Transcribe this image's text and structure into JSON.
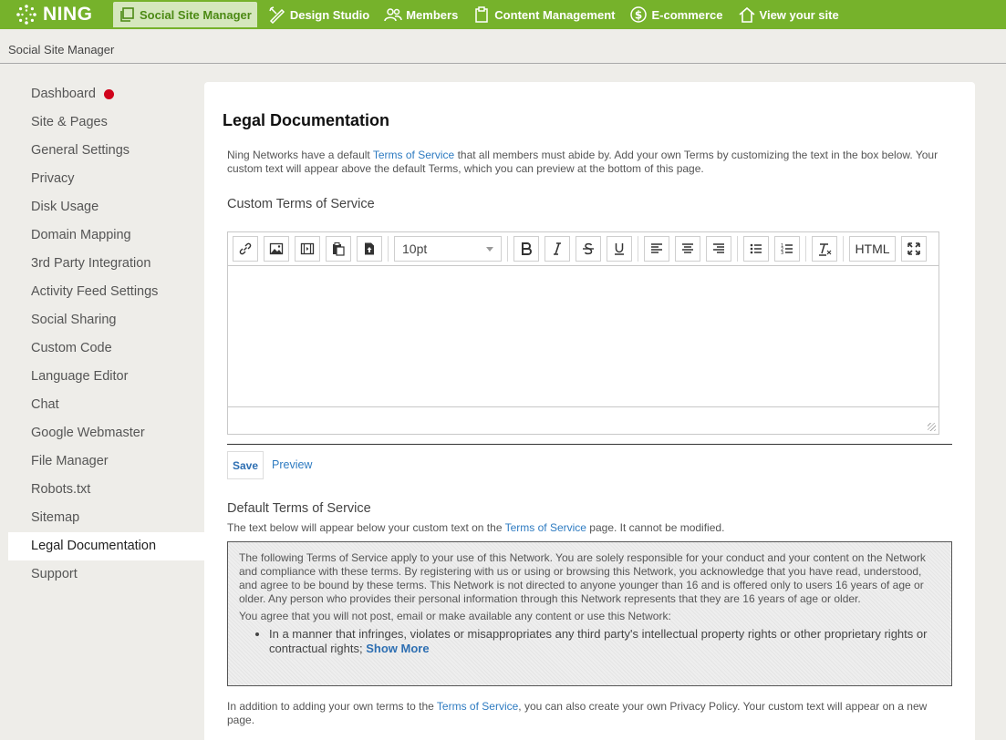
{
  "app": {
    "logo_text": "NING",
    "nav": [
      {
        "label": "Social Site Manager",
        "icon": "copy-window-icon"
      },
      {
        "label": "Design Studio",
        "icon": "design-pencil-icon"
      },
      {
        "label": "Members",
        "icon": "members-icon"
      },
      {
        "label": "Content Management",
        "icon": "clipboard-icon"
      },
      {
        "label": "E-commerce",
        "icon": "dollar-icon"
      },
      {
        "label": "View your site",
        "icon": "home-icon"
      }
    ],
    "brand_color": "#76b22b"
  },
  "breadcrumb": "Social Site Manager",
  "sidebar": {
    "items": [
      "Dashboard",
      "Site & Pages",
      "General Settings",
      "Privacy",
      "Disk Usage",
      "Domain Mapping",
      "3rd Party Integration",
      "Activity Feed Settings",
      "Social Sharing",
      "Custom Code",
      "Language Editor",
      "Chat",
      "Google Webmaster",
      "File Manager",
      "Robots.txt",
      "Sitemap",
      "Legal Documentation",
      "Support"
    ],
    "active": "Legal Documentation"
  },
  "main": {
    "title": "Legal Documentation",
    "intro_before": "Ning Networks have a default ",
    "intro_link": "Terms of Service",
    "intro_after": " that all members must abide by. Add your own Terms by customizing the text in the box below. Your custom text will appear above the default Terms, which you can preview at the bottom of this page.",
    "custom_heading": "Custom Terms of Service",
    "editor": {
      "font_size": "10pt",
      "html_label": "HTML",
      "content": ""
    },
    "save_label": "Save",
    "preview_label": "Preview",
    "default_heading": "Default Terms of Service",
    "default_note_before": "The text below will appear below your custom text on the ",
    "default_note_link": "Terms of Service",
    "default_note_after": " page. It cannot be modified.",
    "tos_para1": "The following Terms of Service apply to your use of this Network. You are solely responsible for your conduct and your content on the Network and compliance with these terms. By registering with us or using or browsing this Network, you acknowledge that you have read, understood, and agree to be bound by these terms. This Network is not directed to anyone younger than 16 and is offered only to users 16 years of age or older. Any person who provides their personal information through this Network represents that they are 16 years of age or older.",
    "tos_para2": "You agree that you will not post, email or make available any content or use this Network:",
    "tos_bullet1": "In a manner that infringes, violates or misappropriates any third party's intellectual property rights or other proprietary rights or contractual rights;",
    "show_more": "Show More",
    "footer_before": "In addition to adding your own terms to the ",
    "footer_link": "Terms of Service",
    "footer_after": ", you can also create your own Privacy Policy. Your custom text will appear on a new page."
  }
}
